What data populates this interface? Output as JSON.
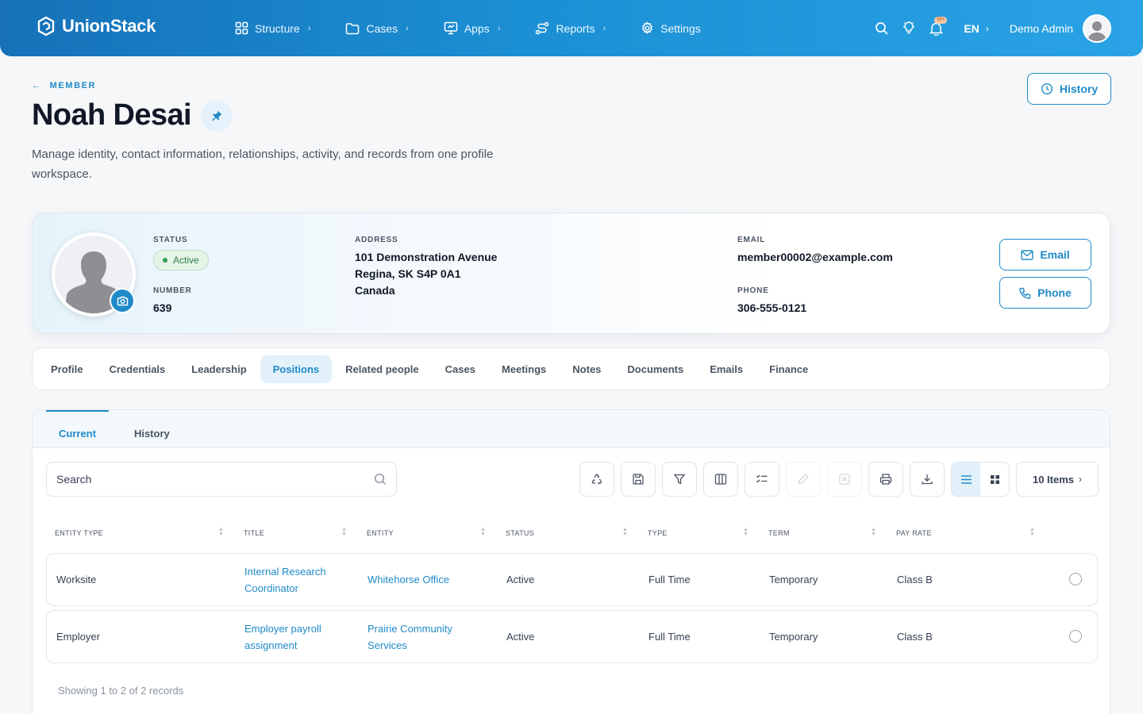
{
  "app": {
    "brand": "UnionStack",
    "nav": [
      {
        "label": "Structure",
        "icon": "grid-icon"
      },
      {
        "label": "Cases",
        "icon": "folder-icon"
      },
      {
        "label": "Apps",
        "icon": "monitor-icon"
      },
      {
        "label": "Reports",
        "icon": "route-icon"
      },
      {
        "label": "Settings",
        "icon": "gear-icon"
      }
    ],
    "language": "EN",
    "user_name": "Demo Admin",
    "notification_badge": "99+"
  },
  "header": {
    "eyebrow": "MEMBER",
    "title": "Noah Desai",
    "description": "Manage identity, contact information, relationships, activity, and records from one profile workspace.",
    "history_button": "History"
  },
  "profile": {
    "status_label": "STATUS",
    "status_value": "Active",
    "number_label": "NUMBER",
    "number_value": "639",
    "address_label": "ADDRESS",
    "address_line1": "101 Demonstration Avenue",
    "address_line2": "Regina, SK S4P 0A1",
    "address_line3": "Canada",
    "email_label": "EMAIL",
    "email_value": "member00002@example.com",
    "phone_label": "PHONE",
    "phone_value": "306-555-0121",
    "email_button": "Email",
    "phone_button": "Phone"
  },
  "tabs": [
    "Profile",
    "Credentials",
    "Leadership",
    "Positions",
    "Related people",
    "Cases",
    "Meetings",
    "Notes",
    "Documents",
    "Emails",
    "Finance"
  ],
  "active_tab": "Positions",
  "subtabs": [
    "Current",
    "History"
  ],
  "toolbar": {
    "search_placeholder": "Search",
    "items_label": "10 Items"
  },
  "table": {
    "columns": [
      "ENTITY TYPE",
      "TITLE",
      "ENTITY",
      "STATUS",
      "TYPE",
      "TERM",
      "PAY RATE"
    ],
    "rows": [
      {
        "entity_type": "Worksite",
        "title": "Internal Research Coordinator",
        "entity": "Whitehorse Office",
        "status": "Active",
        "type": "Full Time",
        "term": "Temporary",
        "pay_rate": "Class B"
      },
      {
        "entity_type": "Employer",
        "title": "Employer payroll assignment",
        "entity": "Prairie Community Services",
        "status": "Active",
        "type": "Full Time",
        "term": "Temporary",
        "pay_rate": "Class B"
      }
    ],
    "footer": "Showing 1 to 2 of 2 records"
  },
  "colors": {
    "primary": "#1f8ac7",
    "topbar_start": "#1671b8",
    "topbar_end": "#2aa3e6",
    "status_green": "#2f9e55"
  }
}
